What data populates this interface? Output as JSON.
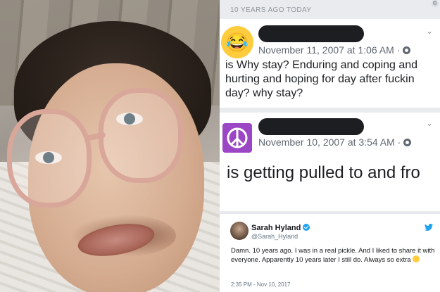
{
  "header": {
    "label": "10 YEARS AGO TODAY"
  },
  "posts": [
    {
      "avatar_icon": "laughing-emoji-icon",
      "timestamp": "November 11, 2007 at 1:06 AM ·",
      "text": "is Why stay? Enduring and coping and hurting and hoping for day after fuckin day? why stay?"
    },
    {
      "avatar_icon": "peace-sign-icon",
      "timestamp": "November 10, 2007 at 3:54 AM ·",
      "text": "is getting pulled to and fro"
    }
  ],
  "tweet": {
    "name": "Sarah Hyland",
    "handle": "@Sarah_Hyland",
    "text": "Damn. 10 years ago. I was in a real pickle. And I liked to share it with everyone. Apparently 10 years later I still do. Always so extra",
    "time": "2:35 PM - Nov 10, 2017"
  },
  "colors": {
    "panel_bg": "#e9ebee",
    "peace_avatar": "#9b47c5",
    "twitter_blue": "#1da1f2"
  }
}
